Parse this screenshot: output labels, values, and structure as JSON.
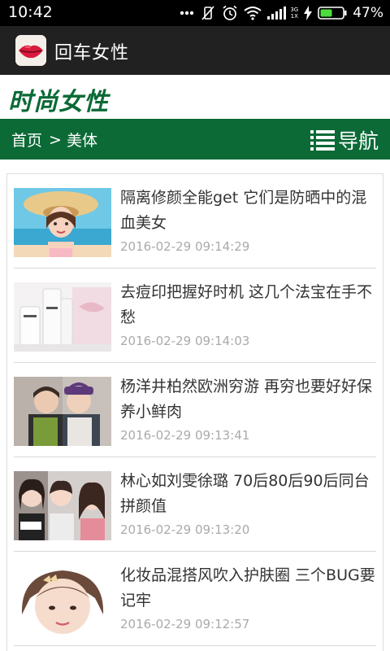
{
  "status": {
    "time": "10:42",
    "network_top": "3G",
    "network_bottom": "1X",
    "battery": "47%"
  },
  "app": {
    "title": "回车女性"
  },
  "site": {
    "logo": "时尚女性"
  },
  "nav": {
    "breadcrumb_home": "首页",
    "breadcrumb_sep": ">",
    "breadcrumb_current": "美体",
    "menu_label": "导航"
  },
  "articles": [
    {
      "title": "隔离修颜全能get 它们是防晒中的混血美女",
      "date": "2016-02-29 09:14:29"
    },
    {
      "title": "去痘印把握好时机 这几个法宝在手不愁",
      "date": "2016-02-29 09:14:03"
    },
    {
      "title": "杨洋井柏然欧洲穷游 再穷也要好好保养小鲜肉",
      "date": "2016-02-29 09:13:41"
    },
    {
      "title": "林心如刘雯徐璐 70后80后90后同台拼颜值",
      "date": "2016-02-29 09:13:20"
    },
    {
      "title": "化妆品混搭风吹入护肤圈 三个BUG要记牢",
      "date": "2016-02-29 09:12:57"
    }
  ],
  "colors": {
    "brand_green": "#0b6a36",
    "appbar": "#212121"
  }
}
